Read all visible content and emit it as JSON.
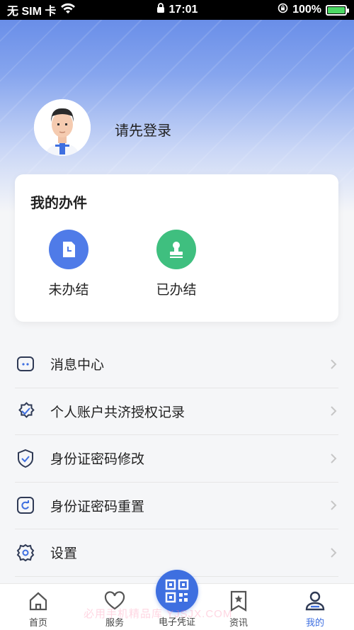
{
  "status_bar": {
    "carrier": "无 SIM 卡",
    "time": "17:01",
    "battery": "100%"
  },
  "profile": {
    "login_prompt": "请先登录"
  },
  "my_items": {
    "title": "我的办件",
    "items": [
      {
        "label": "未办结",
        "icon": "document-clock-icon",
        "color": "#4f7be8"
      },
      {
        "label": "已办结",
        "icon": "stamp-icon",
        "color": "#3fbf7f"
      }
    ]
  },
  "menu": [
    {
      "label": "消息中心",
      "icon": "message-icon"
    },
    {
      "label": "个人账户共济授权记录",
      "icon": "verified-badge-icon"
    },
    {
      "label": "身份证密码修改",
      "icon": "shield-check-icon"
    },
    {
      "label": "身份证密码重置",
      "icon": "reset-icon"
    },
    {
      "label": "设置",
      "icon": "gear-icon"
    }
  ],
  "tabbar": {
    "tabs": [
      {
        "label": "首页",
        "icon": "home-icon"
      },
      {
        "label": "服务",
        "icon": "heart-icon"
      },
      {
        "label": "电子凭证",
        "icon": "qr-code-icon"
      },
      {
        "label": "资讯",
        "icon": "bookmark-star-icon"
      },
      {
        "label": "我的",
        "icon": "user-icon"
      }
    ],
    "active": "我的"
  },
  "watermark": "必用手机精品库 YJSJX.COM",
  "colors": {
    "accent": "#3e6fe0",
    "green": "#3fbf7f",
    "header_top": "#5f86e6"
  }
}
